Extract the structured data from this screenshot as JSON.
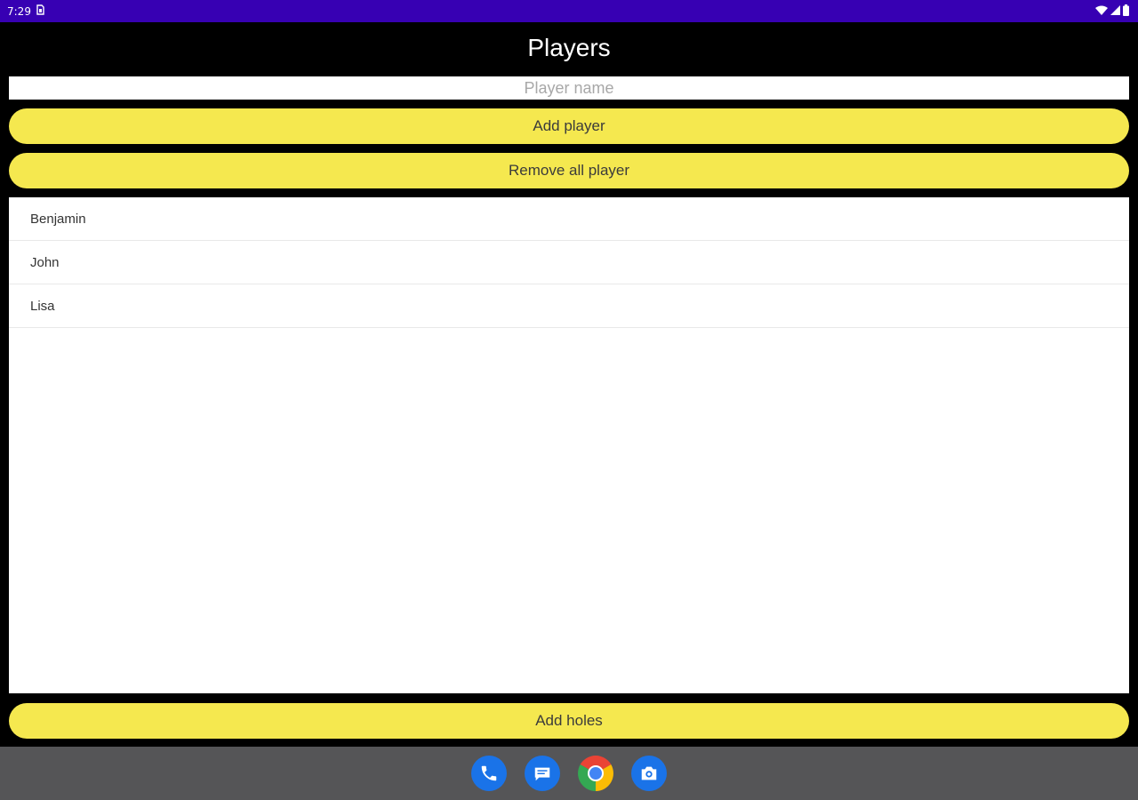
{
  "status_bar": {
    "time": "7:29",
    "bg_color": "#3700b3"
  },
  "app_bar": {
    "title": "Players"
  },
  "player_input": {
    "value": "",
    "placeholder": "Player name"
  },
  "buttons": {
    "add_player": "Add player",
    "remove_all": "Remove all player",
    "add_holes": "Add holes",
    "accent_color": "#f5e84f"
  },
  "players": [
    {
      "name": "Benjamin"
    },
    {
      "name": "John"
    },
    {
      "name": "Lisa"
    }
  ],
  "dock": {
    "icons": [
      "phone-icon",
      "messages-icon",
      "chrome-icon",
      "camera-icon"
    ]
  }
}
